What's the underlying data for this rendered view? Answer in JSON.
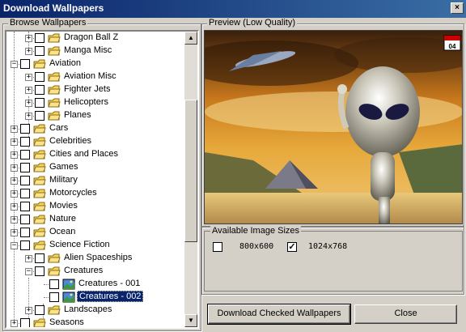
{
  "window": {
    "title": "Download Wallpapers",
    "close_glyph": "×"
  },
  "browse": {
    "legend": "Browse Wallpapers"
  },
  "preview": {
    "legend": "Preview (Low Quality)",
    "badge": "04"
  },
  "sizes": {
    "legend": "Available Image Sizes",
    "options": [
      {
        "label": "800x600",
        "checked": false
      },
      {
        "label": "1024x768",
        "checked": true
      }
    ]
  },
  "tree": [
    {
      "label": "Dragon Ball Z",
      "level": 1,
      "expander": "+",
      "icon": "folder"
    },
    {
      "label": "Manga Misc",
      "level": 1,
      "expander": "+",
      "icon": "folder"
    },
    {
      "label": "Aviation",
      "level": 0,
      "expander": "−",
      "icon": "folder"
    },
    {
      "label": "Aviation Misc",
      "level": 1,
      "expander": "+",
      "icon": "folder"
    },
    {
      "label": "Fighter Jets",
      "level": 1,
      "expander": "+",
      "icon": "folder"
    },
    {
      "label": "Helicopters",
      "level": 1,
      "expander": "+",
      "icon": "folder"
    },
    {
      "label": "Planes",
      "level": 1,
      "expander": "+",
      "icon": "folder"
    },
    {
      "label": "Cars",
      "level": 0,
      "expander": "+",
      "icon": "folder"
    },
    {
      "label": "Celebrities",
      "level": 0,
      "expander": "+",
      "icon": "folder"
    },
    {
      "label": "Cities and Places",
      "level": 0,
      "expander": "+",
      "icon": "folder"
    },
    {
      "label": "Games",
      "level": 0,
      "expander": "+",
      "icon": "folder"
    },
    {
      "label": "Military",
      "level": 0,
      "expander": "+",
      "icon": "folder"
    },
    {
      "label": "Motorcycles",
      "level": 0,
      "expander": "+",
      "icon": "folder"
    },
    {
      "label": "Movies",
      "level": 0,
      "expander": "+",
      "icon": "folder"
    },
    {
      "label": "Nature",
      "level": 0,
      "expander": "+",
      "icon": "folder"
    },
    {
      "label": "Ocean",
      "level": 0,
      "expander": "+",
      "icon": "folder"
    },
    {
      "label": "Science Fiction",
      "level": 0,
      "expander": "−",
      "icon": "folder"
    },
    {
      "label": "Alien Spaceships",
      "level": 1,
      "expander": "+",
      "icon": "folder"
    },
    {
      "label": "Creatures",
      "level": 1,
      "expander": "−",
      "icon": "folder"
    },
    {
      "label": "Creatures - 001",
      "level": 2,
      "expander": "",
      "icon": "image"
    },
    {
      "label": "Creatures - 002",
      "level": 2,
      "expander": "",
      "icon": "image",
      "selected": true
    },
    {
      "label": "Landscapes",
      "level": 1,
      "expander": "+",
      "icon": "folder"
    },
    {
      "label": "Seasons",
      "level": 0,
      "expander": "+",
      "icon": "folder"
    }
  ],
  "buttons": {
    "download": "Download Checked Wallpapers",
    "close": "Close"
  },
  "colors": {
    "titlebar": "#0a246a",
    "selection": "#0a246a",
    "face": "#d4d0c8"
  }
}
